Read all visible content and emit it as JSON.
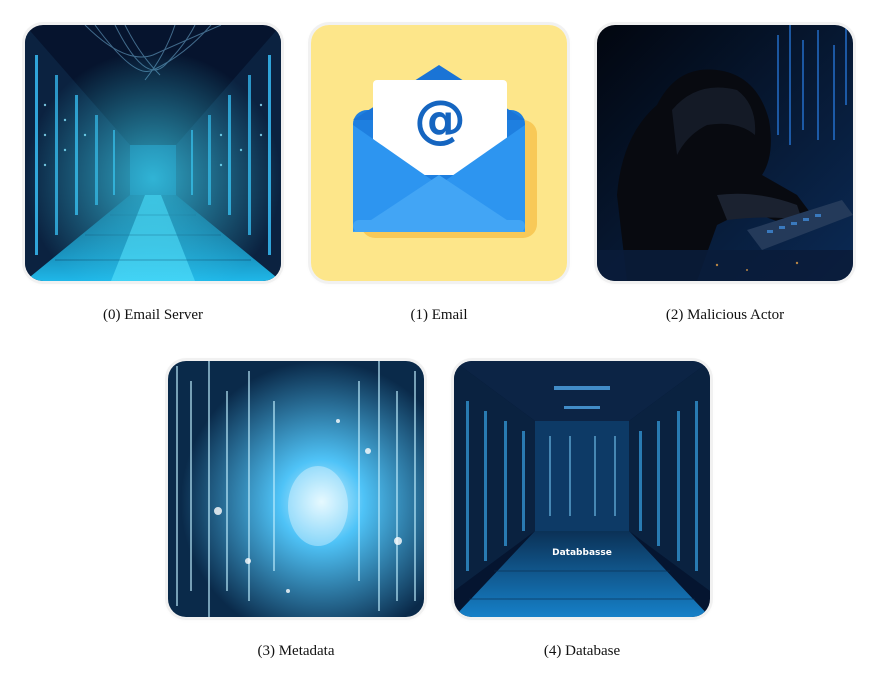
{
  "items": [
    {
      "caption": "(0) Email Server",
      "icon": "server-room-icon"
    },
    {
      "caption": "(1) Email",
      "icon": "email-envelope-icon",
      "symbol": "@"
    },
    {
      "caption": "(2) Malicious Actor",
      "icon": "hooded-hacker-icon"
    },
    {
      "caption": "(3) Metadata",
      "icon": "data-stream-icon"
    },
    {
      "caption": "(4) Database",
      "icon": "database-room-icon",
      "overlay_text": "Databbasse"
    }
  ],
  "colors": {
    "server_bg": "#06142e",
    "server_glow": "#29c7ff",
    "email_bg": "#fde68a",
    "envelope": "#1e88e5",
    "hacker_bg": "#040b1c",
    "metadata_bg": "#0a2a4a",
    "database_bg": "#051530"
  }
}
